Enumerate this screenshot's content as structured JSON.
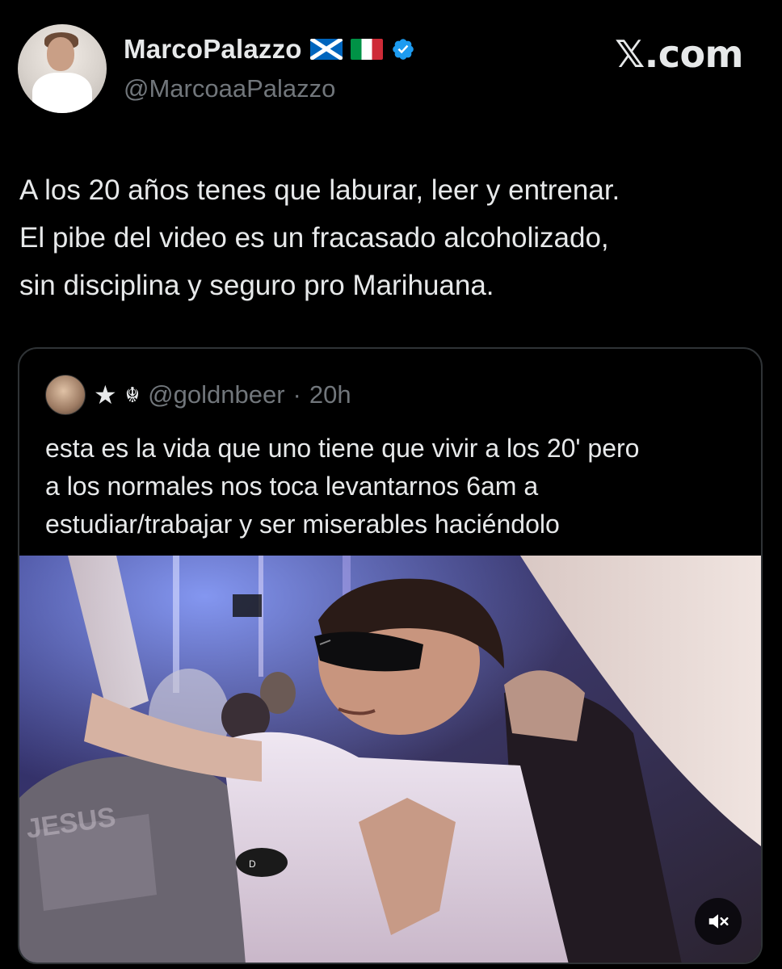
{
  "author": {
    "display_name": "MarcoPalazzo",
    "handle": "@MarcoaaPalazzo",
    "flags": [
      "scotland-flag",
      "italy-flag"
    ],
    "verified": true
  },
  "brand": "𝕏.com",
  "tweet": {
    "lines": [
      "A los 20 años tenes que laburar, leer y entrenar.",
      "El pibe del video es un fracasado alcoholizado,",
      "sin disciplina y seguro pro Marihuana."
    ]
  },
  "quoted": {
    "badges": [
      "★",
      "☬"
    ],
    "handle": "@goldnbeer",
    "separator": "·",
    "time": "20h",
    "lines": [
      "esta es la vida que uno tiene que vivir a los 20' pero",
      "a los normales nos toca levantarnos 6am a",
      "estudiar/trabajar y ser miserables haciéndolo"
    ],
    "video": {
      "muted": true
    }
  },
  "colors": {
    "background": "#000000",
    "text": "#e7e9ea",
    "secondary": "#71767b",
    "border": "#2f3336",
    "verified": "#1d9bf0"
  }
}
